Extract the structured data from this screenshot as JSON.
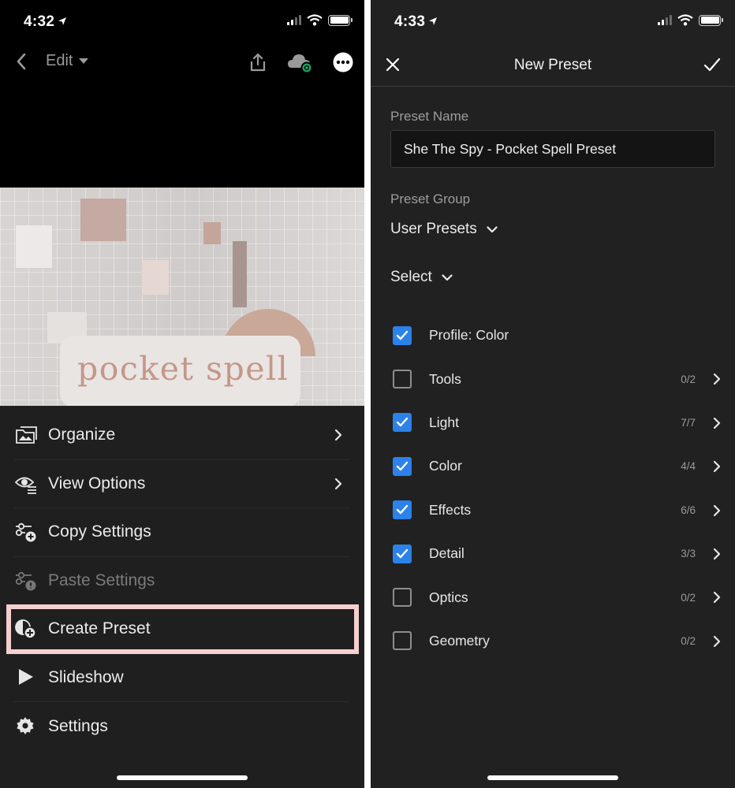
{
  "left": {
    "status_time": "4:32",
    "topbar": {
      "edit_label": "Edit"
    },
    "photo_text": "pocket spell",
    "menu": [
      {
        "label": "Organize",
        "icon": "organize-icon",
        "has_chevron": true,
        "disabled": false
      },
      {
        "label": "View Options",
        "icon": "view-options-icon",
        "has_chevron": true,
        "disabled": false
      },
      {
        "label": "Copy Settings",
        "icon": "copy-settings-icon",
        "has_chevron": false,
        "disabled": false
      },
      {
        "label": "Paste Settings",
        "icon": "paste-settings-icon",
        "has_chevron": false,
        "disabled": true
      },
      {
        "label": "Create Preset",
        "icon": "create-preset-icon",
        "has_chevron": false,
        "disabled": false,
        "highlighted": true
      },
      {
        "label": "Slideshow",
        "icon": "play-icon",
        "has_chevron": false,
        "disabled": false
      },
      {
        "label": "Settings",
        "icon": "gear-icon",
        "has_chevron": false,
        "disabled": false
      }
    ]
  },
  "right": {
    "status_time": "4:33",
    "title": "New Preset",
    "preset_name_label": "Preset Name",
    "preset_name_value": "She The Spy - Pocket Spell Preset",
    "preset_group_label": "Preset Group",
    "preset_group_value": "User Presets",
    "select_label": "Select",
    "settings": [
      {
        "label": "Profile: Color",
        "checked": true,
        "count": "",
        "has_chevron": false
      },
      {
        "label": "Tools",
        "checked": false,
        "count": "0/2",
        "has_chevron": true
      },
      {
        "label": "Light",
        "checked": true,
        "count": "7/7",
        "has_chevron": true
      },
      {
        "label": "Color",
        "checked": true,
        "count": "4/4",
        "has_chevron": true
      },
      {
        "label": "Effects",
        "checked": true,
        "count": "6/6",
        "has_chevron": true
      },
      {
        "label": "Detail",
        "checked": true,
        "count": "3/3",
        "has_chevron": true
      },
      {
        "label": "Optics",
        "checked": false,
        "count": "0/2",
        "has_chevron": true
      },
      {
        "label": "Geometry",
        "checked": false,
        "count": "0/2",
        "has_chevron": true
      }
    ]
  },
  "colors": {
    "accent": "#2c82e8",
    "highlight_border": "#f6cfcf",
    "background": "#1f1f1f"
  }
}
